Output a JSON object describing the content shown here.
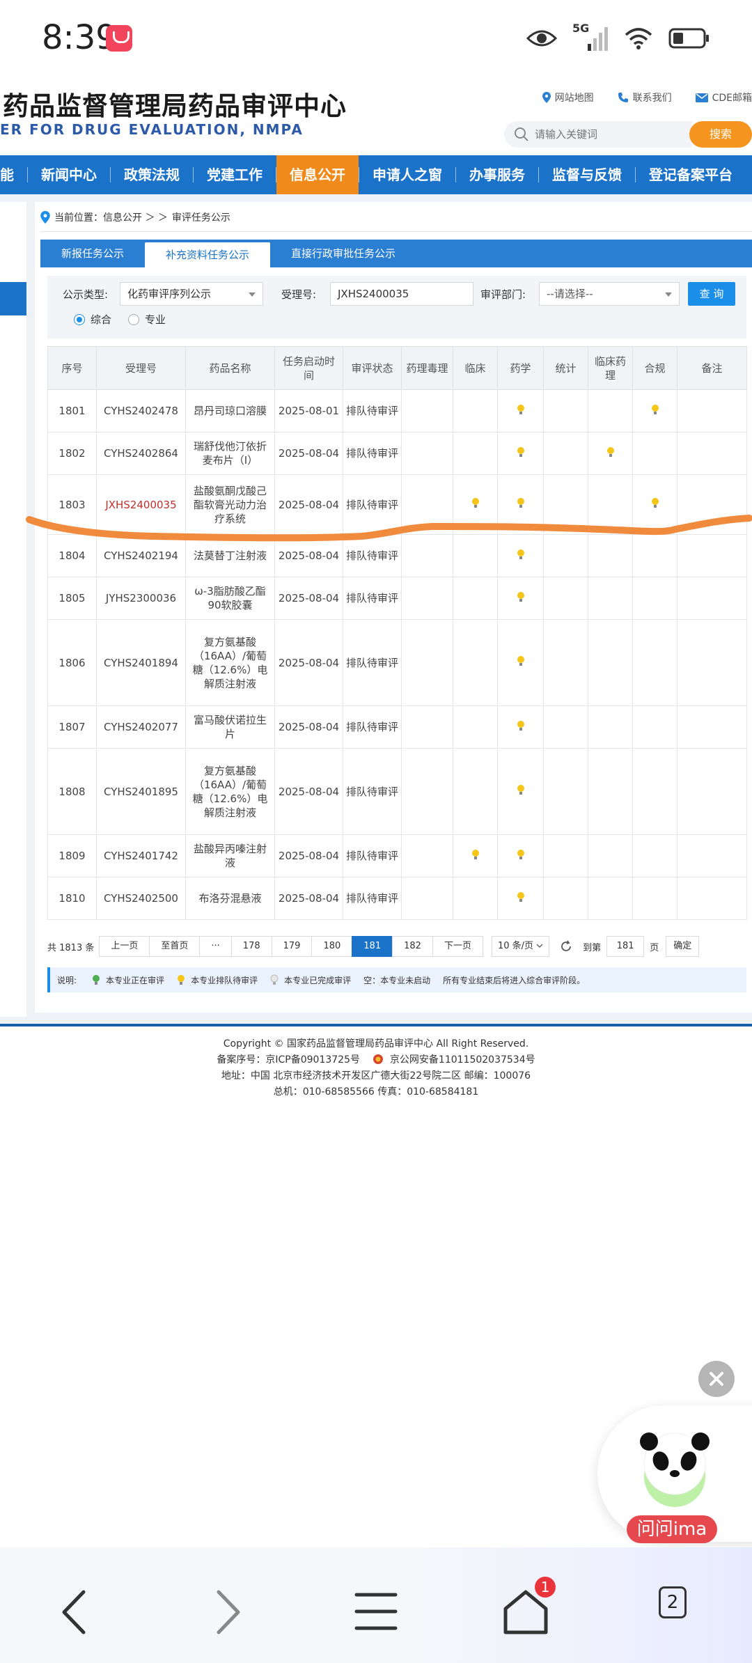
{
  "status_bar": {
    "time": "8:39",
    "network": "5G",
    "icons": [
      "app-notification-icon",
      "eye-icon",
      "signal-icon",
      "wifi-icon",
      "battery-icon"
    ]
  },
  "header": {
    "title": "药品监督管理局药品审评中心",
    "subtitle": "ER FOR DRUG EVALUATION, NMPA",
    "links": [
      "网站地图",
      "联系我们",
      "CDE邮箱"
    ],
    "search_placeholder": "请输入关键词",
    "search_button": "搜索"
  },
  "nav": {
    "items": [
      "能",
      "新闻中心",
      "政策法规",
      "党建工作",
      "信息公开",
      "申请人之窗",
      "办事服务",
      "监督与反馈",
      "登记备案平台"
    ],
    "active": "信息公开"
  },
  "breadcrumb": {
    "prefix": "当前位置：信息公开 ＞ ＞",
    "current": "审评任务公示"
  },
  "tabs": [
    "新报任务公示",
    "补充资料任务公示",
    "直接行政审批任务公示"
  ],
  "filter": {
    "type_label": "公示类型:",
    "type_value": "化药审评序列公示",
    "accept_label": "受理号:",
    "accept_value": "JXHS2400035",
    "dept_label": "审评部门:",
    "dept_value": "--请选择--",
    "query_button": "查 询",
    "radio_all": "综合",
    "radio_specialty": "专业"
  },
  "table": {
    "headers": [
      "序号",
      "受理号",
      "药品名称",
      "任务启动时间",
      "审评状态",
      "药理毒理",
      "临床",
      "药学",
      "统计",
      "临床药理",
      "合规",
      "备注"
    ],
    "rows": [
      {
        "no": "1801",
        "accept": "CYHS2402478",
        "drug": "昂丹司琼口溶膜",
        "date": "2025-08-01",
        "status": "排队待审评",
        "marks": [
          "",
          "",
          "y",
          "",
          "",
          "y",
          ""
        ],
        "hl": false
      },
      {
        "no": "1802",
        "accept": "CYHS2402864",
        "drug": "瑞舒伐他汀依折麦布片（I）",
        "date": "2025-08-04",
        "status": "排队待审评",
        "marks": [
          "",
          "",
          "y",
          "",
          "y",
          "",
          ""
        ],
        "hl": false
      },
      {
        "no": "1803",
        "accept": "JXHS2400035",
        "drug": "盐酸氨酮戊酸己酯软膏光动力治疗系统",
        "date": "2025-08-04",
        "status": "排队待审评",
        "marks": [
          "",
          "y",
          "y",
          "",
          "",
          "y",
          ""
        ],
        "hl": true
      },
      {
        "no": "1804",
        "accept": "CYHS2402194",
        "drug": "法莫替丁注射液",
        "date": "2025-08-04",
        "status": "排队待审评",
        "marks": [
          "",
          "",
          "y",
          "",
          "",
          "",
          ""
        ],
        "hl": false
      },
      {
        "no": "1805",
        "accept": "JYHS2300036",
        "drug": "ω-3脂肪酸乙酯90软胶囊",
        "date": "2025-08-04",
        "status": "排队待审评",
        "marks": [
          "",
          "",
          "y",
          "",
          "",
          "",
          ""
        ],
        "hl": false
      },
      {
        "no": "1806",
        "accept": "CYHS2401894",
        "drug": "复方氨基酸（16AA）/葡萄糖（12.6%）电解质注射液",
        "date": "2025-08-04",
        "status": "排队待审评",
        "marks": [
          "",
          "",
          "y",
          "",
          "",
          "",
          ""
        ],
        "hl": false
      },
      {
        "no": "1807",
        "accept": "CYHS2402077",
        "drug": "富马酸伏诺拉生片",
        "date": "2025-08-04",
        "status": "排队待审评",
        "marks": [
          "",
          "",
          "y",
          "",
          "",
          "",
          ""
        ],
        "hl": false
      },
      {
        "no": "1808",
        "accept": "CYHS2401895",
        "drug": "复方氨基酸（16AA）/葡萄糖（12.6%）电解质注射液",
        "date": "2025-08-04",
        "status": "排队待审评",
        "marks": [
          "",
          "",
          "y",
          "",
          "",
          "",
          ""
        ],
        "hl": false
      },
      {
        "no": "1809",
        "accept": "CYHS2401742",
        "drug": "盐酸异丙嗪注射液",
        "date": "2025-08-04",
        "status": "排队待审评",
        "marks": [
          "",
          "y",
          "y",
          "",
          "",
          "",
          ""
        ],
        "hl": false
      },
      {
        "no": "1810",
        "accept": "CYHS2402500",
        "drug": "布洛芬混悬液",
        "date": "2025-08-04",
        "status": "排队待审评",
        "marks": [
          "",
          "",
          "y",
          "",
          "",
          "",
          ""
        ],
        "hl": false
      }
    ]
  },
  "pager": {
    "total": "共 1813 条",
    "prev": "上一页",
    "first": "至首页",
    "ellipsis": "···",
    "pages": [
      "178",
      "179",
      "180",
      "181",
      "182"
    ],
    "current": "181",
    "next": "下一页",
    "page_size": "10 条/页",
    "goto_label": "到第",
    "goto_value": "181",
    "page_unit": "页",
    "confirm": "确定"
  },
  "legend": {
    "label": "说明:",
    "green": "本专业正在审评",
    "yellow": "本专业排队待审评",
    "gray": "本专业已完成审评",
    "empty": "空：本专业未启动",
    "note": "所有专业结束后将进入综合审评阶段。"
  },
  "footer": {
    "line1": "Copyright © 国家药品监督管理局药品审评中心   All Right Reserved.",
    "line2a": "备案序号：京ICP备09013725号",
    "line2b": "京公网安备11011502037534号",
    "line3": "地址：中国 北京市经济技术开发区广德大街22号院二区     邮编：100076",
    "line4": "总机：010-68585566     传真：010-68584181"
  },
  "assistant": {
    "label": "问问ima"
  },
  "browser_bar": {
    "tab_count": "2",
    "home_badge": "1"
  },
  "colors": {
    "nav_blue": "#1a73c9",
    "active_orange": "#f08a1b",
    "search_orange": "#f5951f",
    "highlight_red": "#c0302b",
    "annotation_stroke": "#f08a3c"
  }
}
